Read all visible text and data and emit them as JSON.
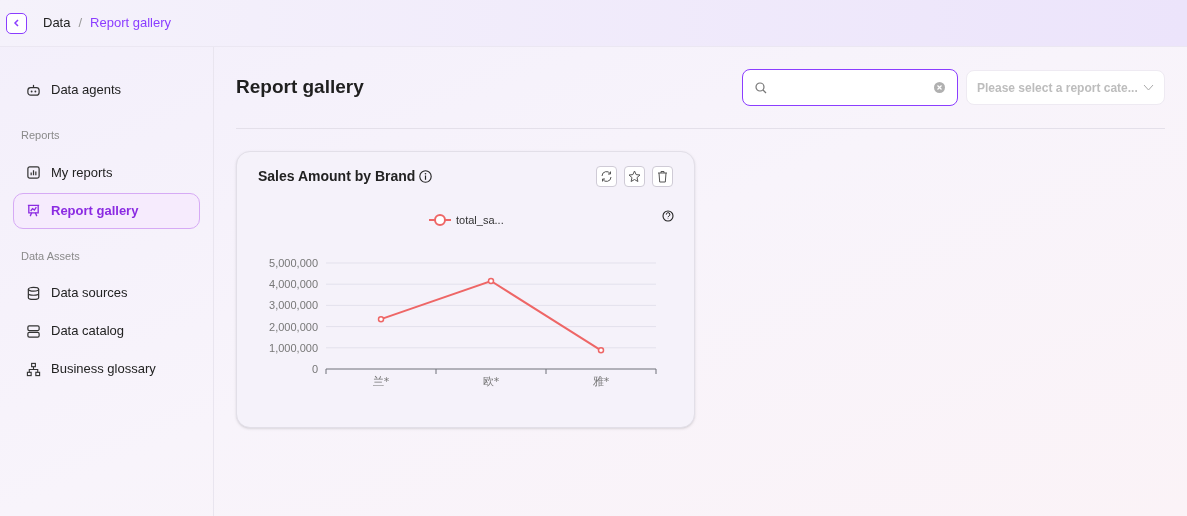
{
  "breadcrumb": [
    {
      "label": "Data",
      "current": false
    },
    {
      "label": "Report gallery",
      "current": true
    }
  ],
  "breadcrumb_separator": "/",
  "sidebar": {
    "items": [
      {
        "kind": "item",
        "label": "Data agents",
        "selected": false
      },
      {
        "kind": "heading",
        "label": "Reports"
      },
      {
        "kind": "item",
        "label": "My reports",
        "selected": false
      },
      {
        "kind": "item",
        "label": "Report gallery",
        "selected": true
      },
      {
        "kind": "heading",
        "label": "Data Assets"
      },
      {
        "kind": "item",
        "label": "Data sources",
        "selected": false
      },
      {
        "kind": "item",
        "label": "Data catalog",
        "selected": false
      },
      {
        "kind": "item",
        "label": "Business glossary",
        "selected": false
      }
    ]
  },
  "page_title": "Report gallery",
  "category_select": {
    "placeholder": "Please select a report cate..."
  },
  "cards": [
    {
      "title": "Sales Amount by Brand",
      "chart_data": {
        "type": "line",
        "grid": true,
        "categories": [
          "兰*",
          "欧*",
          "雅*"
        ],
        "series": [
          {
            "name": "total_sa...",
            "color": "#ee6666",
            "marker": "circle",
            "values": [
              2350000,
              4150000,
              880000
            ]
          }
        ],
        "ylim": [
          0,
          5000000
        ],
        "yticks": [
          {
            "value": 0,
            "label": "0"
          },
          {
            "value": 1000000,
            "label": "1,000,000"
          },
          {
            "value": 2000000,
            "label": "2,000,000"
          },
          {
            "value": 3000000,
            "label": "3,000,000"
          },
          {
            "value": 4000000,
            "label": "4,000,000"
          },
          {
            "value": 5000000,
            "label": "5,000,000"
          }
        ]
      }
    }
  ]
}
